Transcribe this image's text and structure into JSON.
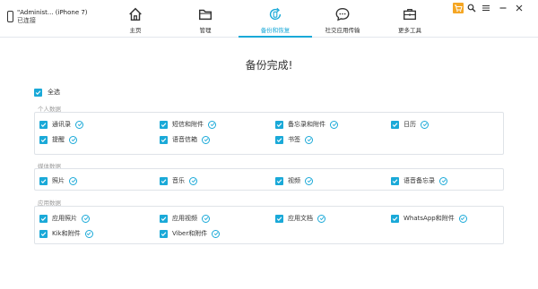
{
  "device": {
    "name": "\"Administ... (iPhone 7)",
    "status": "已连接"
  },
  "nav": [
    {
      "label": "主页",
      "icon": "home-icon"
    },
    {
      "label": "管理",
      "icon": "folder-icon"
    },
    {
      "label": "备份和恢复",
      "icon": "backup-restore-icon",
      "active": true
    },
    {
      "label": "社交应用传输",
      "icon": "chat-icon"
    },
    {
      "label": "更多工具",
      "icon": "toolbox-icon"
    }
  ],
  "title": "备份完成!",
  "select_all": "全选",
  "groups": [
    {
      "title": "个人数据",
      "items": [
        {
          "label": "通讯录",
          "done": true
        },
        {
          "label": "短信和附件",
          "done": true
        },
        {
          "label": "备忘录和附件",
          "done": true
        },
        {
          "label": "日历",
          "done": true
        },
        {
          "label": "提醒",
          "done": true
        },
        {
          "label": "语音信箱",
          "done": true
        },
        {
          "label": "书签",
          "done": true
        }
      ]
    },
    {
      "title": "媒体数据",
      "items": [
        {
          "label": "照片",
          "done": true
        },
        {
          "label": "音乐",
          "done": true
        },
        {
          "label": "视频",
          "done": true
        },
        {
          "label": "语音备忘录",
          "done": true
        }
      ]
    },
    {
      "title": "应用数据",
      "items": [
        {
          "label": "应用照片",
          "done": true
        },
        {
          "label": "应用视频",
          "done": true
        },
        {
          "label": "应用文档",
          "done": true
        },
        {
          "label": "WhatsApp和附件",
          "done": true
        },
        {
          "label": "Kik和附件",
          "done": true
        },
        {
          "label": "Viber和附件",
          "done": true
        }
      ]
    }
  ],
  "colors": {
    "accent": "#1aa9d8",
    "cart": "#f5a623"
  }
}
